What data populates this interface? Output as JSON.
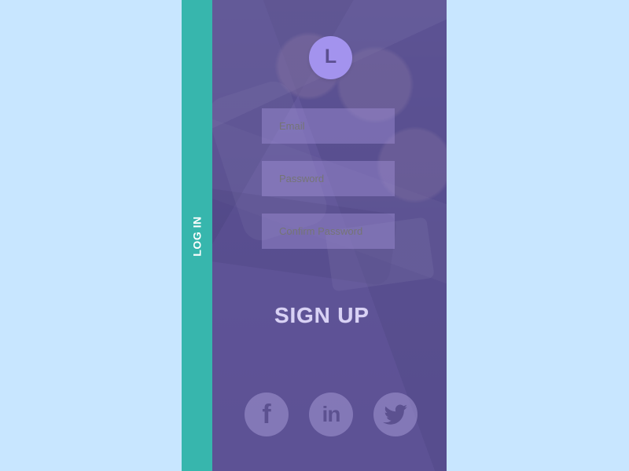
{
  "app": {
    "background_color": "#c8e6ff",
    "panel_color": "#5c4f93",
    "accent_color": "#37b6ad",
    "logo_color": "#a393ee"
  },
  "side_tab": {
    "label": "LOG IN"
  },
  "logo": {
    "letter": "L",
    "icon": "brand-logo-icon"
  },
  "form": {
    "email_placeholder": "Email",
    "password_placeholder": "Password",
    "confirm_password_placeholder": "Confirm Password"
  },
  "actions": {
    "sign_up_label": "SIGN UP"
  },
  "social": {
    "facebook_icon": "facebook-icon",
    "linkedin_icon": "linkedin-icon",
    "twitter_icon": "twitter-icon",
    "facebook_glyph": "f",
    "linkedin_glyph": "in"
  }
}
